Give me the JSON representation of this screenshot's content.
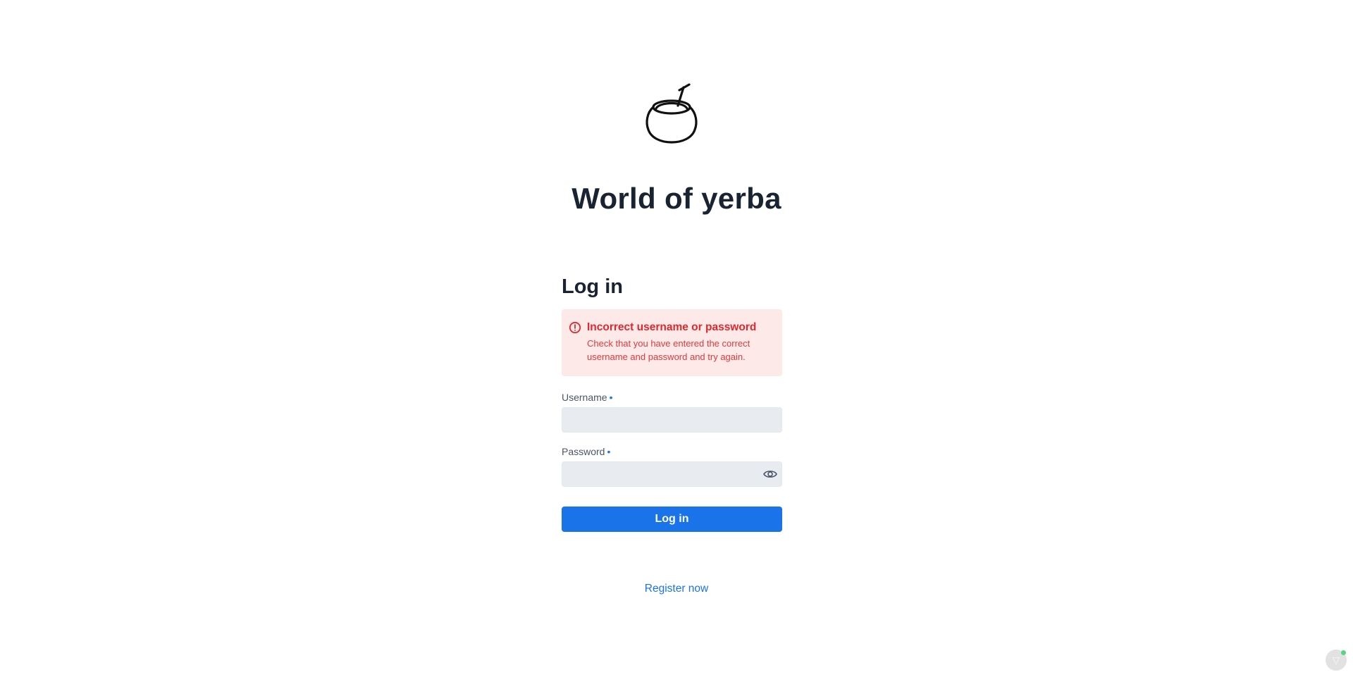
{
  "app": {
    "title": "World of yerba",
    "logo_icon": "yerba-mate-gourd-icon"
  },
  "login": {
    "heading": "Log in",
    "alert": {
      "icon": "alert-circle-icon",
      "title": "Incorrect username or password",
      "description": "Check that you have entered the correct username and password and try again.",
      "color": "#e0282c",
      "background": "#fee9e9"
    },
    "username": {
      "label": "Username",
      "required_marker": "•",
      "value": "",
      "placeholder": ""
    },
    "password": {
      "label": "Password",
      "required_marker": "•",
      "value": "",
      "placeholder": "",
      "toggle_icon": "eye-icon"
    },
    "submit_label": "Log in",
    "register_link": "Register now"
  },
  "colors": {
    "primary": "#1a73e8",
    "title_text": "#1a2332",
    "input_background": "#e8ecf1"
  },
  "corner_widget": {
    "icon": "devtools-badge-icon",
    "glyph": "▽",
    "status_color": "#22c55e"
  }
}
